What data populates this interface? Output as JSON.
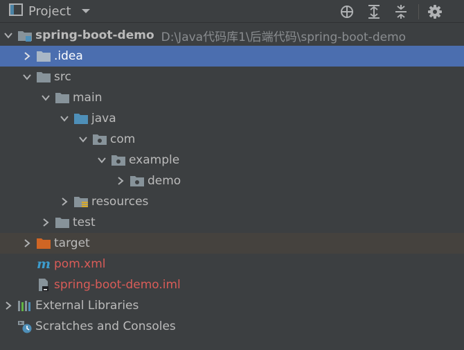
{
  "toolbar": {
    "title": "Project",
    "icons": [
      "project-window-icon",
      "chevron-down-icon",
      "locate-icon",
      "expand-all-icon",
      "collapse-all-icon",
      "gear-icon"
    ]
  },
  "tree": {
    "root": {
      "label": "spring-boot-demo",
      "path": "D:\\Java代码库1\\后端代码\\spring-boot-demo"
    },
    "idea": {
      "label": ".idea"
    },
    "src": {
      "label": "src"
    },
    "main": {
      "label": "main"
    },
    "java": {
      "label": "java"
    },
    "com": {
      "label": "com"
    },
    "example": {
      "label": "example"
    },
    "demo": {
      "label": "demo"
    },
    "resources": {
      "label": "resources"
    },
    "test": {
      "label": "test"
    },
    "target": {
      "label": "target"
    },
    "pom": {
      "label": "pom.xml"
    },
    "iml": {
      "label": "spring-boot-demo.iml"
    },
    "external_libraries": {
      "label": "External Libraries"
    },
    "scratches": {
      "label": "Scratches and Consoles"
    }
  },
  "colors": {
    "background": "#3c3f41",
    "selection": "#4b6eaf",
    "excluded_row": "#45423e",
    "text": "#bbbbbb",
    "modified_text": "#d95c58",
    "folder_gray": "#87939a",
    "source_folder": "#4e8fb8",
    "excluded_folder": "#d06524"
  }
}
